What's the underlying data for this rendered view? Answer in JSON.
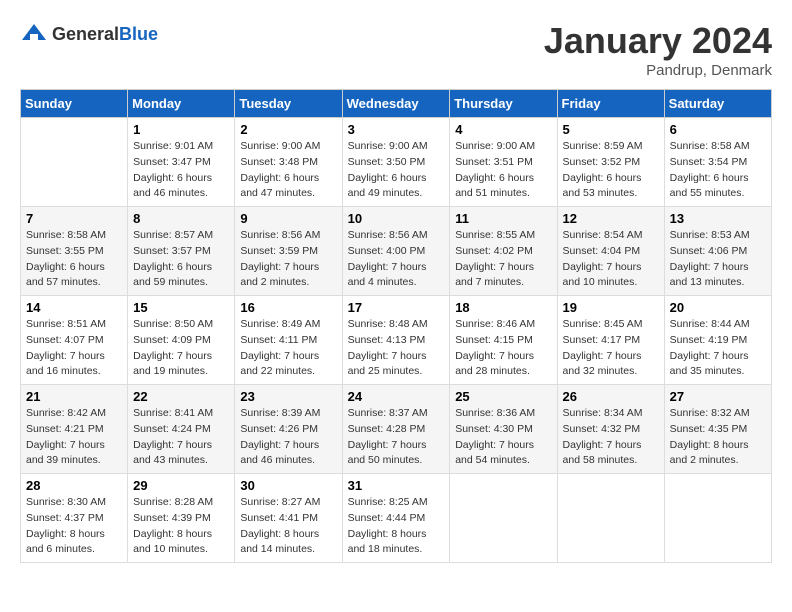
{
  "header": {
    "logo_general": "General",
    "logo_blue": "Blue",
    "month_title": "January 2024",
    "location": "Pandrup, Denmark"
  },
  "columns": [
    "Sunday",
    "Monday",
    "Tuesday",
    "Wednesday",
    "Thursday",
    "Friday",
    "Saturday"
  ],
  "weeks": [
    [
      {
        "day": "",
        "sunrise": "",
        "sunset": "",
        "daylight": ""
      },
      {
        "day": "1",
        "sunrise": "Sunrise: 9:01 AM",
        "sunset": "Sunset: 3:47 PM",
        "daylight": "Daylight: 6 hours and 46 minutes."
      },
      {
        "day": "2",
        "sunrise": "Sunrise: 9:00 AM",
        "sunset": "Sunset: 3:48 PM",
        "daylight": "Daylight: 6 hours and 47 minutes."
      },
      {
        "day": "3",
        "sunrise": "Sunrise: 9:00 AM",
        "sunset": "Sunset: 3:50 PM",
        "daylight": "Daylight: 6 hours and 49 minutes."
      },
      {
        "day": "4",
        "sunrise": "Sunrise: 9:00 AM",
        "sunset": "Sunset: 3:51 PM",
        "daylight": "Daylight: 6 hours and 51 minutes."
      },
      {
        "day": "5",
        "sunrise": "Sunrise: 8:59 AM",
        "sunset": "Sunset: 3:52 PM",
        "daylight": "Daylight: 6 hours and 53 minutes."
      },
      {
        "day": "6",
        "sunrise": "Sunrise: 8:58 AM",
        "sunset": "Sunset: 3:54 PM",
        "daylight": "Daylight: 6 hours and 55 minutes."
      }
    ],
    [
      {
        "day": "7",
        "sunrise": "Sunrise: 8:58 AM",
        "sunset": "Sunset: 3:55 PM",
        "daylight": "Daylight: 6 hours and 57 minutes."
      },
      {
        "day": "8",
        "sunrise": "Sunrise: 8:57 AM",
        "sunset": "Sunset: 3:57 PM",
        "daylight": "Daylight: 6 hours and 59 minutes."
      },
      {
        "day": "9",
        "sunrise": "Sunrise: 8:56 AM",
        "sunset": "Sunset: 3:59 PM",
        "daylight": "Daylight: 7 hours and 2 minutes."
      },
      {
        "day": "10",
        "sunrise": "Sunrise: 8:56 AM",
        "sunset": "Sunset: 4:00 PM",
        "daylight": "Daylight: 7 hours and 4 minutes."
      },
      {
        "day": "11",
        "sunrise": "Sunrise: 8:55 AM",
        "sunset": "Sunset: 4:02 PM",
        "daylight": "Daylight: 7 hours and 7 minutes."
      },
      {
        "day": "12",
        "sunrise": "Sunrise: 8:54 AM",
        "sunset": "Sunset: 4:04 PM",
        "daylight": "Daylight: 7 hours and 10 minutes."
      },
      {
        "day": "13",
        "sunrise": "Sunrise: 8:53 AM",
        "sunset": "Sunset: 4:06 PM",
        "daylight": "Daylight: 7 hours and 13 minutes."
      }
    ],
    [
      {
        "day": "14",
        "sunrise": "Sunrise: 8:51 AM",
        "sunset": "Sunset: 4:07 PM",
        "daylight": "Daylight: 7 hours and 16 minutes."
      },
      {
        "day": "15",
        "sunrise": "Sunrise: 8:50 AM",
        "sunset": "Sunset: 4:09 PM",
        "daylight": "Daylight: 7 hours and 19 minutes."
      },
      {
        "day": "16",
        "sunrise": "Sunrise: 8:49 AM",
        "sunset": "Sunset: 4:11 PM",
        "daylight": "Daylight: 7 hours and 22 minutes."
      },
      {
        "day": "17",
        "sunrise": "Sunrise: 8:48 AM",
        "sunset": "Sunset: 4:13 PM",
        "daylight": "Daylight: 7 hours and 25 minutes."
      },
      {
        "day": "18",
        "sunrise": "Sunrise: 8:46 AM",
        "sunset": "Sunset: 4:15 PM",
        "daylight": "Daylight: 7 hours and 28 minutes."
      },
      {
        "day": "19",
        "sunrise": "Sunrise: 8:45 AM",
        "sunset": "Sunset: 4:17 PM",
        "daylight": "Daylight: 7 hours and 32 minutes."
      },
      {
        "day": "20",
        "sunrise": "Sunrise: 8:44 AM",
        "sunset": "Sunset: 4:19 PM",
        "daylight": "Daylight: 7 hours and 35 minutes."
      }
    ],
    [
      {
        "day": "21",
        "sunrise": "Sunrise: 8:42 AM",
        "sunset": "Sunset: 4:21 PM",
        "daylight": "Daylight: 7 hours and 39 minutes."
      },
      {
        "day": "22",
        "sunrise": "Sunrise: 8:41 AM",
        "sunset": "Sunset: 4:24 PM",
        "daylight": "Daylight: 7 hours and 43 minutes."
      },
      {
        "day": "23",
        "sunrise": "Sunrise: 8:39 AM",
        "sunset": "Sunset: 4:26 PM",
        "daylight": "Daylight: 7 hours and 46 minutes."
      },
      {
        "day": "24",
        "sunrise": "Sunrise: 8:37 AM",
        "sunset": "Sunset: 4:28 PM",
        "daylight": "Daylight: 7 hours and 50 minutes."
      },
      {
        "day": "25",
        "sunrise": "Sunrise: 8:36 AM",
        "sunset": "Sunset: 4:30 PM",
        "daylight": "Daylight: 7 hours and 54 minutes."
      },
      {
        "day": "26",
        "sunrise": "Sunrise: 8:34 AM",
        "sunset": "Sunset: 4:32 PM",
        "daylight": "Daylight: 7 hours and 58 minutes."
      },
      {
        "day": "27",
        "sunrise": "Sunrise: 8:32 AM",
        "sunset": "Sunset: 4:35 PM",
        "daylight": "Daylight: 8 hours and 2 minutes."
      }
    ],
    [
      {
        "day": "28",
        "sunrise": "Sunrise: 8:30 AM",
        "sunset": "Sunset: 4:37 PM",
        "daylight": "Daylight: 8 hours and 6 minutes."
      },
      {
        "day": "29",
        "sunrise": "Sunrise: 8:28 AM",
        "sunset": "Sunset: 4:39 PM",
        "daylight": "Daylight: 8 hours and 10 minutes."
      },
      {
        "day": "30",
        "sunrise": "Sunrise: 8:27 AM",
        "sunset": "Sunset: 4:41 PM",
        "daylight": "Daylight: 8 hours and 14 minutes."
      },
      {
        "day": "31",
        "sunrise": "Sunrise: 8:25 AM",
        "sunset": "Sunset: 4:44 PM",
        "daylight": "Daylight: 8 hours and 18 minutes."
      },
      {
        "day": "",
        "sunrise": "",
        "sunset": "",
        "daylight": ""
      },
      {
        "day": "",
        "sunrise": "",
        "sunset": "",
        "daylight": ""
      },
      {
        "day": "",
        "sunrise": "",
        "sunset": "",
        "daylight": ""
      }
    ]
  ]
}
